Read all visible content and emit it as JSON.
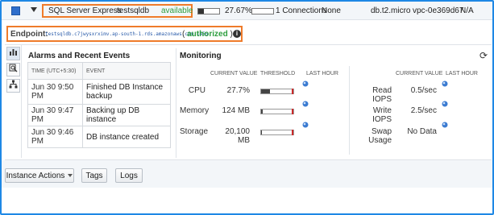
{
  "instance_row": {
    "engine": "SQL Server Express",
    "db_identifier": "testsqldb",
    "status": "available",
    "cpu_percent_text": "27.67%",
    "cpu_fraction": 0.2767,
    "connections_text": "1 Connections",
    "connections_fraction": 0.0,
    "replication": "None",
    "instance_class": "db.t2.micro",
    "vpc": "vpc-0e369d67",
    "multi_az": "N/A"
  },
  "endpoint": {
    "label": "Endpoint:",
    "value": "testsqldb.c7jwysxrximv.ap-south-1.rds.amazonaws.com:1455",
    "open_paren": "(",
    "authorized": "authorized",
    "close_paren": ")"
  },
  "alarms": {
    "title": "Alarms and Recent Events",
    "columns": [
      "TIME (UTC+5:30)",
      "EVENT"
    ],
    "rows": [
      {
        "time": "Jun 30 9:50 PM",
        "event": "Finished DB Instance backup"
      },
      {
        "time": "Jun 30 9:47 PM",
        "event": "Backing up DB instance"
      },
      {
        "time": "Jun 30 9:46 PM",
        "event": "DB instance created"
      }
    ]
  },
  "monitoring": {
    "title": "Monitoring",
    "left_headers": {
      "current": "CURRENT VALUE",
      "threshold": "THRESHOLD",
      "last_hour": "LAST HOUR"
    },
    "right_headers": {
      "current": "CURRENT VALUE",
      "last_hour": "LAST HOUR"
    },
    "left_metrics": [
      {
        "label": "CPU",
        "value": "27.7%",
        "fraction": 0.277
      },
      {
        "label": "Memory",
        "value": "124 MB",
        "fraction": 0.05
      },
      {
        "label": "Storage",
        "value": "20,100 MB",
        "fraction": 0.02
      }
    ],
    "right_metrics": [
      {
        "label": "Read IOPS",
        "value": "0.5/sec"
      },
      {
        "label": "Write IOPS",
        "value": "2.5/sec"
      },
      {
        "label": "Swap Usage",
        "value": "No Data"
      }
    ]
  },
  "actions": {
    "instance_actions": "Instance Actions",
    "tags": "Tags",
    "logs": "Logs"
  },
  "icons": {
    "tool_1": "bar-chart-icon",
    "tool_2": "magnifier-icon",
    "tool_3": "hierarchy-icon",
    "refresh": "refresh-icon",
    "info": "info-icon",
    "sparkline": "sparkline-icon"
  },
  "colors": {
    "accent_highlight": "#ef7b2a",
    "status_green": "#2e9e3f",
    "frame_blue": "#1e88e5",
    "threshold_red": "#cc2a2a"
  }
}
